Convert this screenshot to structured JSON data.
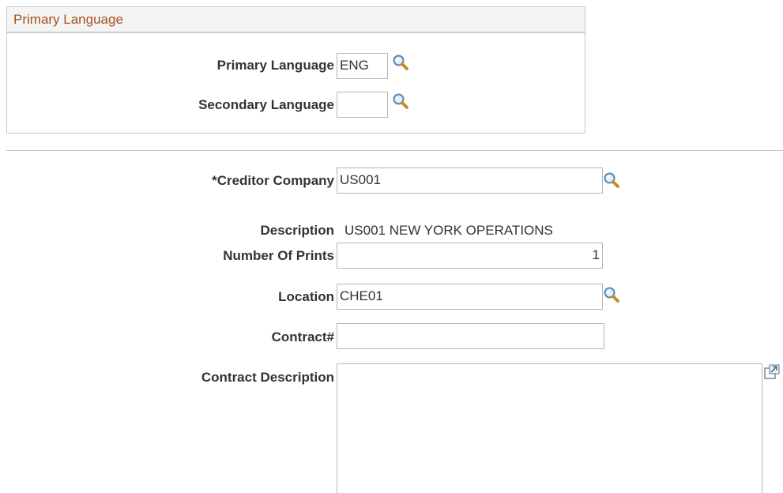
{
  "primary_language_group": {
    "title": "Primary Language",
    "primary_language_label": "Primary Language",
    "primary_language_value": "ENG",
    "secondary_language_label": "Secondary Language",
    "secondary_language_value": ""
  },
  "form": {
    "creditor_company_label": "*Creditor Company",
    "creditor_company_value": "US001",
    "description_label": "Description",
    "description_value": "US001 NEW YORK OPERATIONS",
    "number_of_prints_label": "Number Of Prints",
    "number_of_prints_value": "1",
    "location_label": "Location",
    "location_value": "CHE01",
    "contract_label": "Contract#",
    "contract_value": "",
    "contract_description_label": "Contract Description",
    "contract_description_value": ""
  },
  "icons": {
    "lookup": "magnifier-lookup-icon",
    "expand": "expand-textarea-icon"
  },
  "colors": {
    "group_title": "#a6501e",
    "border": "#b5b5b5"
  }
}
